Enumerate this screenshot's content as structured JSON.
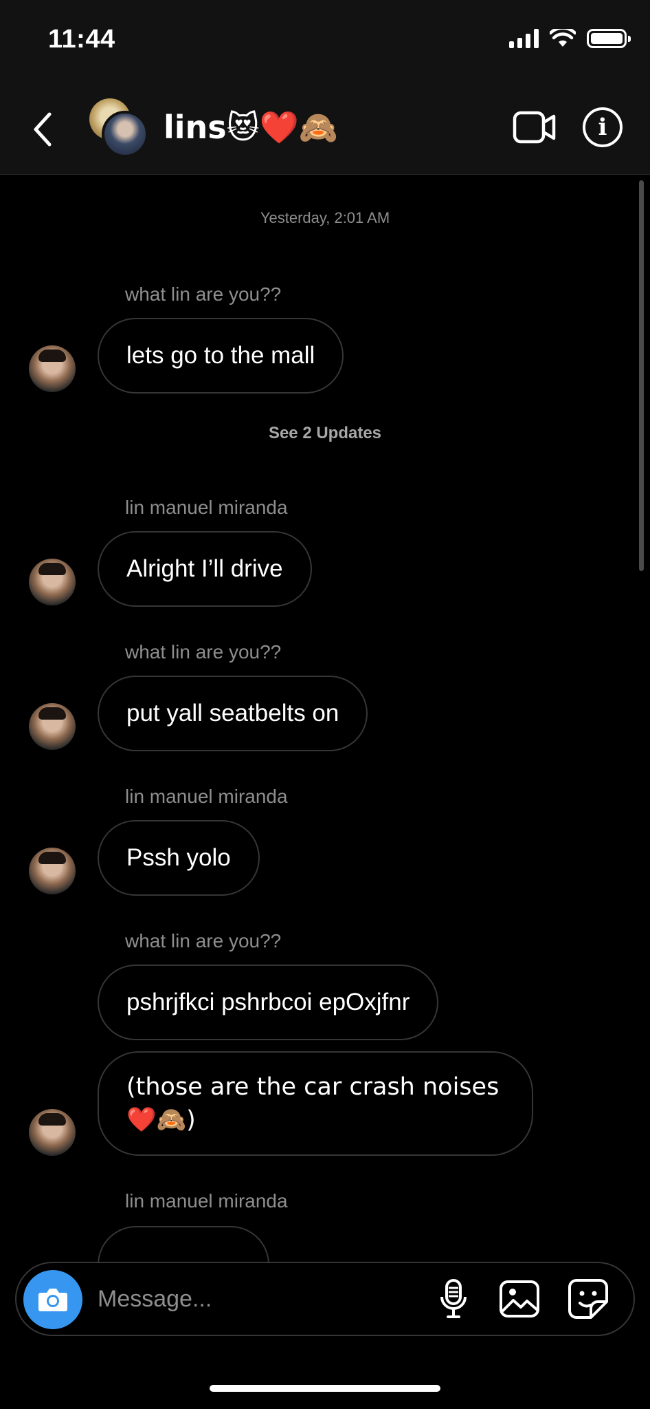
{
  "status_bar": {
    "time": "11:44"
  },
  "header": {
    "title": "lins😻❤️🙈"
  },
  "conversation": {
    "timestamp": "Yesterday, 2:01 AM",
    "see_updates": "See 2 Updates",
    "messages": [
      {
        "sender": "what lin are you??",
        "text": "lets go to the mall"
      },
      {
        "sender": "lin manuel miranda",
        "text": "Alright I’ll drive"
      },
      {
        "sender": "what lin are you??",
        "text": "put yall seatbelts on"
      },
      {
        "sender": "lin manuel miranda",
        "text": "Pssh yolo"
      },
      {
        "sender": "what lin are you??",
        "text": "pshrjfkci pshrbcoi epOxjfnr"
      },
      {
        "sender": "",
        "text": "(those are the car crash noises❤️🙈)"
      },
      {
        "sender": "lin manuel miranda",
        "text": ""
      }
    ]
  },
  "composer": {
    "placeholder": "Message..."
  },
  "colors": {
    "accent": "#3797f0",
    "background": "#000000",
    "header": "#121212"
  },
  "icons": [
    "back-icon",
    "video-call-icon",
    "info-icon",
    "camera-icon",
    "microphone-icon",
    "gallery-icon",
    "sticker-icon"
  ]
}
